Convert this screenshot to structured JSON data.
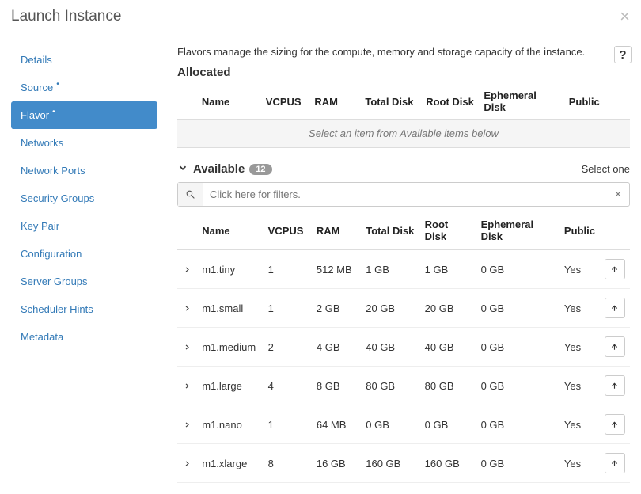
{
  "modal": {
    "title": "Launch Instance"
  },
  "sidebar": {
    "items": [
      {
        "label": "Details",
        "active": false,
        "dot": false
      },
      {
        "label": "Source",
        "active": false,
        "dot": true
      },
      {
        "label": "Flavor",
        "active": true,
        "dot": true
      },
      {
        "label": "Networks",
        "active": false,
        "dot": false
      },
      {
        "label": "Network Ports",
        "active": false,
        "dot": false
      },
      {
        "label": "Security Groups",
        "active": false,
        "dot": false
      },
      {
        "label": "Key Pair",
        "active": false,
        "dot": false
      },
      {
        "label": "Configuration",
        "active": false,
        "dot": false
      },
      {
        "label": "Server Groups",
        "active": false,
        "dot": false
      },
      {
        "label": "Scheduler Hints",
        "active": false,
        "dot": false
      },
      {
        "label": "Metadata",
        "active": false,
        "dot": false
      }
    ]
  },
  "content": {
    "description": "Flavors manage the sizing for the compute, memory and storage capacity of the instance.",
    "allocated": {
      "heading": "Allocated",
      "empty_text": "Select an item from Available items below"
    },
    "columns": {
      "name": "Name",
      "vcpus": "VCPUS",
      "ram": "RAM",
      "total_disk": "Total Disk",
      "root_disk": "Root Disk",
      "ephemeral_disk": "Ephemeral Disk",
      "public": "Public"
    },
    "available": {
      "heading": "Available",
      "count": "12",
      "select_one": "Select one",
      "filter_placeholder": "Click here for filters.",
      "rows": [
        {
          "name": "m1.tiny",
          "vcpus": "1",
          "ram": "512 MB",
          "total": "1 GB",
          "root": "1 GB",
          "eph": "0 GB",
          "public": "Yes"
        },
        {
          "name": "m1.small",
          "vcpus": "1",
          "ram": "2 GB",
          "total": "20 GB",
          "root": "20 GB",
          "eph": "0 GB",
          "public": "Yes"
        },
        {
          "name": "m1.medium",
          "vcpus": "2",
          "ram": "4 GB",
          "total": "40 GB",
          "root": "40 GB",
          "eph": "0 GB",
          "public": "Yes"
        },
        {
          "name": "m1.large",
          "vcpus": "4",
          "ram": "8 GB",
          "total": "80 GB",
          "root": "80 GB",
          "eph": "0 GB",
          "public": "Yes"
        },
        {
          "name": "m1.nano",
          "vcpus": "1",
          "ram": "64 MB",
          "total": "0 GB",
          "root": "0 GB",
          "eph": "0 GB",
          "public": "Yes"
        },
        {
          "name": "m1.xlarge",
          "vcpus": "8",
          "ram": "16 GB",
          "total": "160 GB",
          "root": "160 GB",
          "eph": "0 GB",
          "public": "Yes"
        }
      ]
    }
  }
}
